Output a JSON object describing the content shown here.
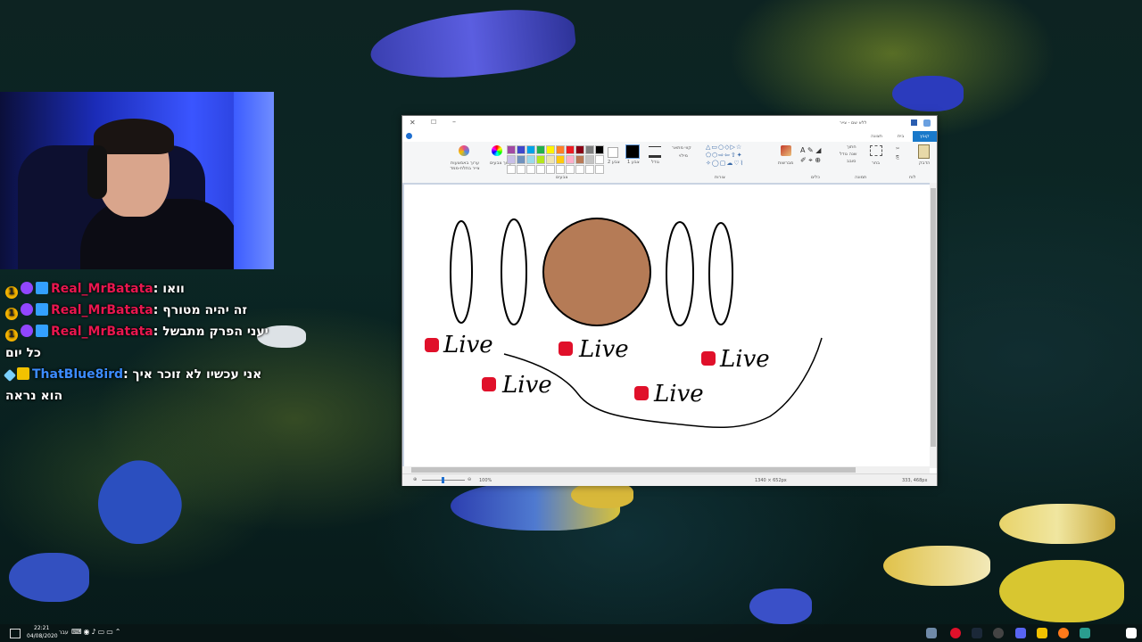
{
  "chat": {
    "messages": [
      {
        "user": "Real_MrBatata",
        "text": "וואו"
      },
      {
        "user": "Real_MrBatata",
        "text": "זה יהיה מטורף"
      },
      {
        "user": "Real_MrBatata",
        "text": "יעני הפרק מתבשל"
      },
      {
        "continuation": "כל יום"
      },
      {
        "user": "ThatBlue8ird",
        "text": "אני עכשיו לא זוכר איך"
      },
      {
        "continuation": "הוא נראה"
      }
    ]
  },
  "paint": {
    "title": "ללא שם - צייר",
    "tabs": [
      "קובץ",
      "בית",
      "תצוגה"
    ],
    "groups": [
      "לוח",
      "תמונה",
      "כלים",
      "צורות",
      "צבעים"
    ],
    "ribbon_labels": {
      "paste": "הדבק",
      "select": "בחר",
      "crop": "חתוך",
      "resize": "שנה גודל",
      "rotate": "סובב",
      "brushes": "מברשות",
      "outline": "קווי מתאר",
      "fill": "מילוי",
      "size": "גודל",
      "color1": "צבע 1",
      "color2": "צבע 2",
      "edit_colors": "ערוך צבעים",
      "edit_paint3d": "ערוך באמצעות צייר בתלת-ממד"
    },
    "canvas_text": [
      "Live",
      "Live",
      "Live",
      "Live",
      "Live"
    ],
    "status": {
      "zoom": "100%",
      "canvas_size": "1340 × 652px",
      "cursor": "333, 468px"
    }
  },
  "taskbar": {
    "time": "22:21",
    "date": "04/08/2020",
    "lang": "עבר"
  },
  "colors": {
    "circle_fill": "#b57b56",
    "live_dot": "#e0102a",
    "username_red": "#e8174f",
    "username_blue": "#3c8cff"
  }
}
